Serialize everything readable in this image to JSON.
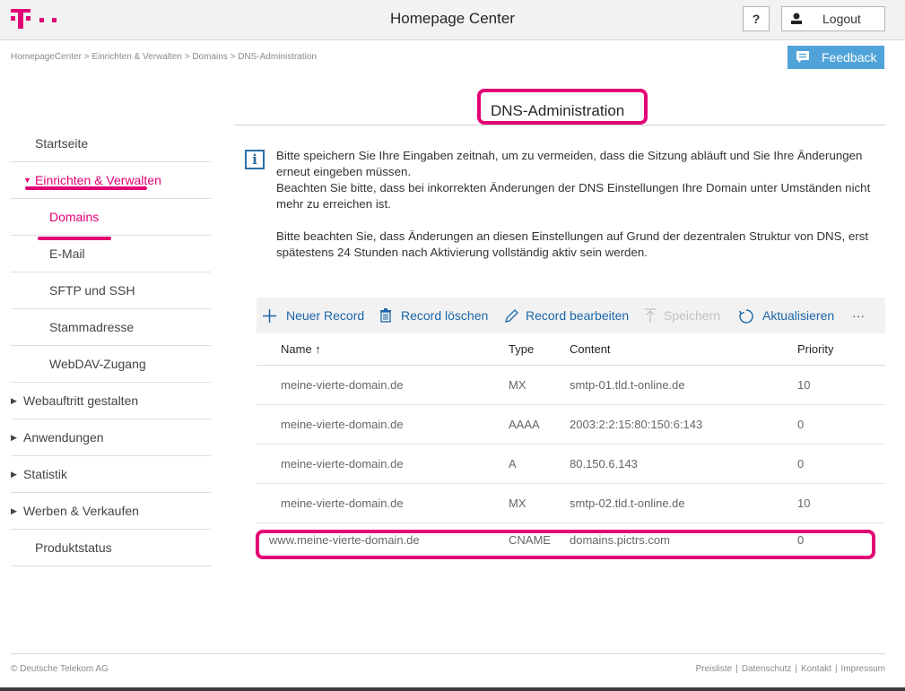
{
  "header": {
    "title": "Homepage Center",
    "help_label": "?",
    "logout_label": "Logout",
    "brand_color": "#e20074"
  },
  "breadcrumb": "HomepageCenter > Einrichten & Verwalten  > Domains  > DNS-Administration",
  "feedback_label": "Feedback",
  "page_title": "DNS-Administration",
  "sidebar": {
    "items": [
      {
        "label": "Startseite"
      },
      {
        "label": "Einrichten & Verwalten"
      },
      {
        "label": "Domains"
      },
      {
        "label": "E-Mail"
      },
      {
        "label": "SFTP und SSH"
      },
      {
        "label": "Stammadresse"
      },
      {
        "label": "WebDAV-Zugang"
      },
      {
        "label": "Webauftritt gestalten"
      },
      {
        "label": "Anwendungen"
      },
      {
        "label": "Statistik"
      },
      {
        "label": "Werben & Verkaufen"
      },
      {
        "label": "Produktstatus"
      }
    ]
  },
  "info": {
    "p1": "Bitte speichern Sie Ihre Eingaben zeitnah, um zu vermeiden, dass die Sitzung abläuft und Sie Ihre Änderungen erneut eingeben müssen.",
    "p2": "Beachten Sie bitte, dass bei inkorrekten Änderungen der DNS Einstellungen Ihre Domain unter Umständen nicht mehr zu erreichen ist.",
    "p3": "Bitte beachten Sie, dass Änderungen an diesen Einstellungen auf Grund der dezentralen Struktur von DNS, erst spätestens 24 Stunden nach Aktivierung vollständig aktiv sein werden."
  },
  "toolbar": {
    "new_record": "Neuer Record",
    "delete_record": "Record löschen",
    "edit_record": "Record bearbeiten",
    "save": "Speichern",
    "refresh": "Aktualisieren",
    "more": "···"
  },
  "table": {
    "headers": {
      "name": "Name ↑",
      "type": "Type",
      "content": "Content",
      "priority": "Priority"
    },
    "rows": [
      {
        "name": "meine-vierte-domain.de",
        "type": "MX",
        "content": "smtp-01.tld.t-online.de",
        "priority": "10"
      },
      {
        "name": "meine-vierte-domain.de",
        "type": "AAAA",
        "content": "2003:2:2:15:80:150:6:143",
        "priority": "0"
      },
      {
        "name": "meine-vierte-domain.de",
        "type": "A",
        "content": "80.150.6.143",
        "priority": "0"
      },
      {
        "name": "meine-vierte-domain.de",
        "type": "MX",
        "content": "smtp-02.tld.t-online.de",
        "priority": "10"
      },
      {
        "name": "www.meine-vierte-domain.de",
        "type": "CNAME",
        "content": "domains.pictrs.com",
        "priority": "0"
      }
    ]
  },
  "footer": {
    "copyright": "© Deutsche Telekom AG",
    "links": [
      "Preisliste",
      "Datenschutz",
      "Kontakt",
      "Impressum"
    ]
  }
}
